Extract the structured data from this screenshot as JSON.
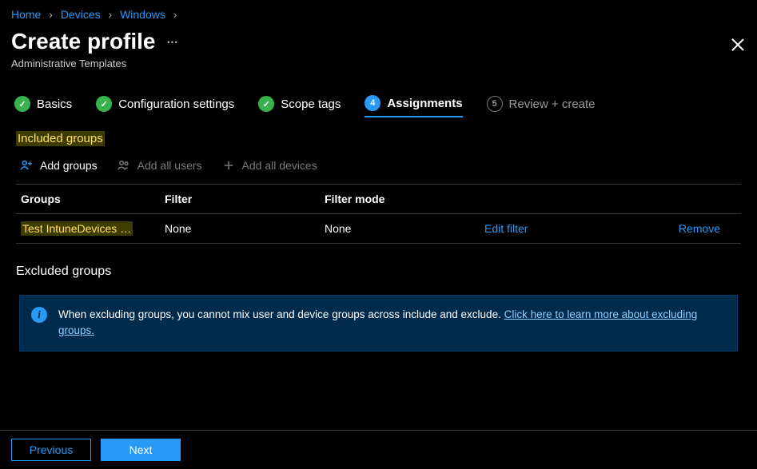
{
  "breadcrumb": {
    "home": "Home",
    "devices": "Devices",
    "windows": "Windows"
  },
  "header": {
    "title": "Create profile",
    "subtitle": "Administrative Templates"
  },
  "steps": {
    "s1": {
      "label": "Basics"
    },
    "s2": {
      "label": "Configuration settings"
    },
    "s3": {
      "label": "Scope tags"
    },
    "s4": {
      "num": "4",
      "label": "Assignments"
    },
    "s5": {
      "num": "5",
      "label": "Review + create"
    }
  },
  "sections": {
    "included": "Included groups",
    "excluded": "Excluded groups"
  },
  "toolbar": {
    "add_groups": "Add groups",
    "add_all_users": "Add all users",
    "add_all_devices": "Add all devices"
  },
  "table": {
    "headers": {
      "groups": "Groups",
      "filter": "Filter",
      "filter_mode": "Filter mode"
    },
    "row1": {
      "group": "Test IntuneDevices …",
      "filter": "None",
      "filter_mode": "None",
      "edit": "Edit filter",
      "remove": "Remove"
    }
  },
  "info": {
    "text": "When excluding groups, you cannot mix user and device groups across include and exclude. ",
    "link": "Click here to learn more about excluding groups."
  },
  "footer": {
    "previous": "Previous",
    "next": "Next"
  }
}
